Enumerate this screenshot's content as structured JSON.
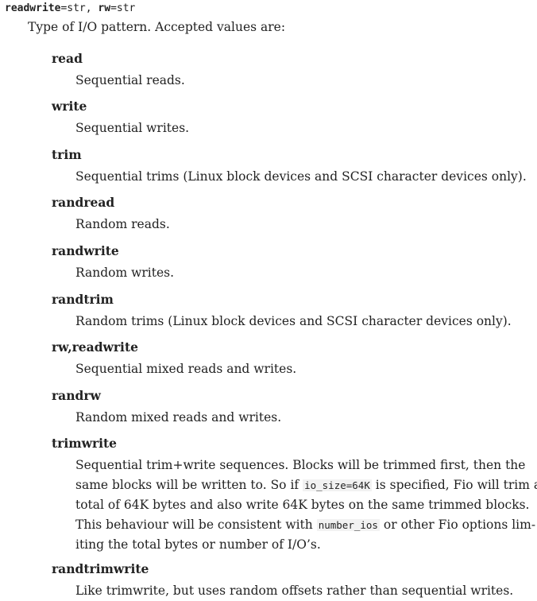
{
  "signature": {
    "name1": "readwrite",
    "eq1": "=str, ",
    "name2": "rw",
    "eq2": "=str"
  },
  "intro": "Type of I/O pattern. Accepted values are:",
  "entries": [
    {
      "term": "read",
      "desc": "Sequential reads."
    },
    {
      "term": "write",
      "desc": "Sequential writes."
    },
    {
      "term": "trim",
      "desc": "Sequential trims (Linux block devices and SCSI character devices only)."
    },
    {
      "term": "randread",
      "desc": "Random reads."
    },
    {
      "term": "randwrite",
      "desc": "Random writes."
    },
    {
      "term": "randtrim",
      "desc": "Random trims (Linux block devices and SCSI character devices only)."
    },
    {
      "term": "rw,readwrite",
      "desc": "Sequential mixed reads and writes."
    },
    {
      "term": "randrw",
      "desc": "Random mixed reads and writes."
    },
    {
      "term": "trimwrite",
      "desc": ""
    },
    {
      "term": "randtrimwrite",
      "desc": "Like trimwrite, but uses random offsets rather than sequential writes."
    }
  ],
  "trimwrite_desc": {
    "line1": "Sequential trim+write sequences. Blocks will be trimmed first, then the",
    "line2_a": "same blocks will be written to. So if ",
    "line2_code": "io_size=64K",
    "line2_b": " is specified, Fio will trim a",
    "line3": "total of 64K bytes and also write 64K bytes on the same trimmed blocks.",
    "line4_a": "This behaviour will be consistent with ",
    "line4_code": "number_ios",
    "line4_b": " or other Fio options lim-",
    "line5": "iting the total bytes or number of I/O’s."
  }
}
